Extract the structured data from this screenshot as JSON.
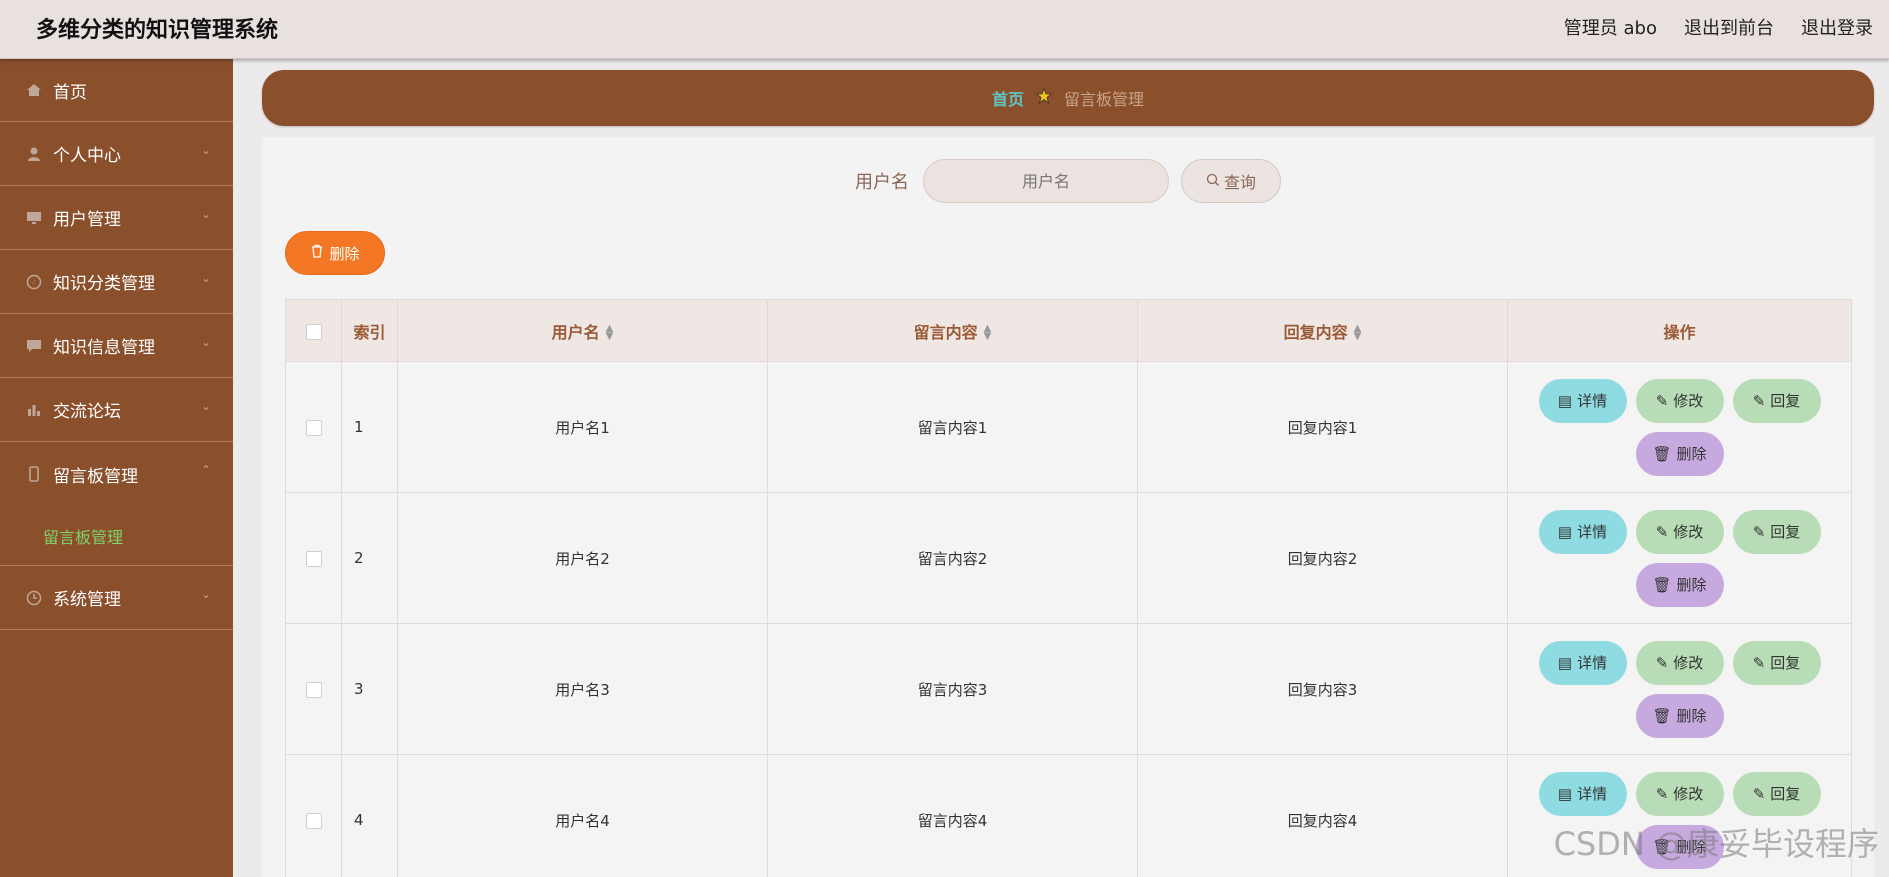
{
  "header": {
    "title": "多维分类的知识管理系统",
    "admin_label": "管理员 abo",
    "front_label": "退出到前台",
    "logout_label": "退出登录"
  },
  "sidebar": {
    "items": [
      {
        "label": "首页",
        "icon": "home-icon"
      },
      {
        "label": "个人中心",
        "icon": "user-icon"
      },
      {
        "label": "用户管理",
        "icon": "monitor-icon"
      },
      {
        "label": "知识分类管理",
        "icon": "compass-icon"
      },
      {
        "label": "知识信息管理",
        "icon": "message-icon"
      },
      {
        "label": "交流论坛",
        "icon": "chart-icon"
      },
      {
        "label": "留言板管理",
        "icon": "phone-icon"
      },
      {
        "label": "系统管理",
        "icon": "clock-icon"
      }
    ],
    "submenu_active": "留言板管理"
  },
  "breadcrumb": {
    "home": "首页",
    "current": "留言板管理"
  },
  "search": {
    "label": "用户名",
    "placeholder": "用户名",
    "button": "查询"
  },
  "toolbar": {
    "delete_label": "删除"
  },
  "table": {
    "headers": {
      "index": "索引",
      "username": "用户名",
      "content": "留言内容",
      "reply": "回复内容",
      "ops": "操作"
    },
    "rows": [
      {
        "index": "1",
        "username": "用户名1",
        "content": "留言内容1",
        "reply": "回复内容1"
      },
      {
        "index": "2",
        "username": "用户名2",
        "content": "留言内容2",
        "reply": "回复内容2"
      },
      {
        "index": "3",
        "username": "用户名3",
        "content": "留言内容3",
        "reply": "回复内容3"
      },
      {
        "index": "4",
        "username": "用户名4",
        "content": "留言内容4",
        "reply": "回复内容4"
      }
    ],
    "ops": {
      "detail": "详情",
      "edit": "修改",
      "reply": "回复",
      "delete": "删除"
    }
  },
  "watermark": "CSDN @康妥毕设程序",
  "colors": {
    "sidebar": "#8a4f2b",
    "delete_button": "#f47726",
    "detail_button": "#8fdbe2",
    "edit_button": "#b7dcb6",
    "row_delete_button": "#c6a9df",
    "active_submenu": "#7fd36a"
  }
}
